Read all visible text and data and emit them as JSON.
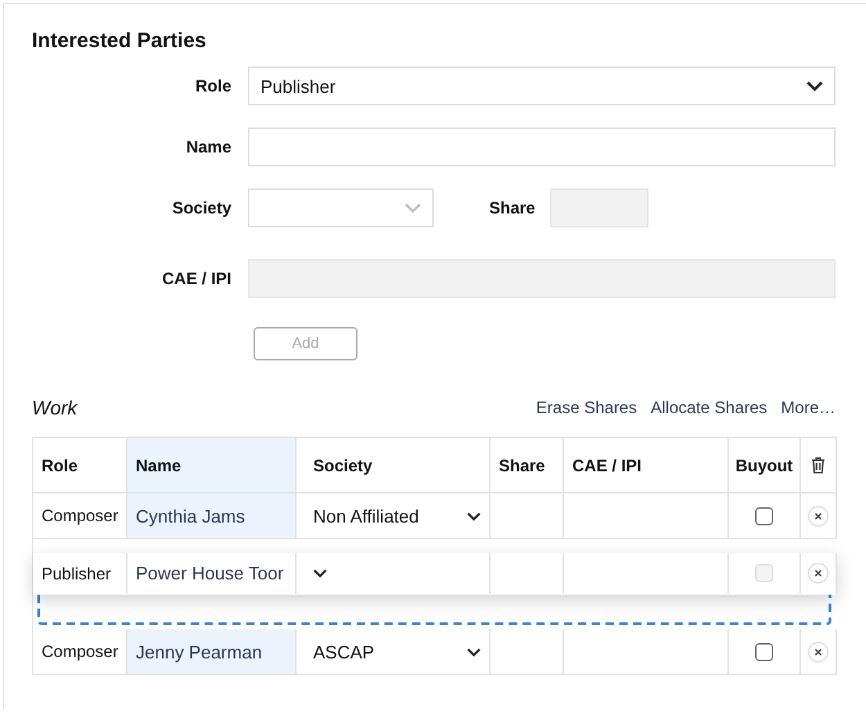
{
  "interested_parties": {
    "title": "Interested Parties",
    "role": {
      "label": "Role",
      "value": "Publisher"
    },
    "name": {
      "label": "Name"
    },
    "society": {
      "label": "Society",
      "disabled": true
    },
    "share": {
      "label": "Share",
      "disabled": true
    },
    "cae_ipi": {
      "label": "CAE / IPI",
      "disabled": true
    },
    "add_button": {
      "label": "Add",
      "disabled": true
    }
  },
  "work": {
    "title": "Work",
    "actions": [
      "Erase Shares",
      "Allocate Shares",
      "More…"
    ],
    "columns": [
      "Role",
      "Name",
      "Society",
      "Share",
      "CAE / IPI",
      "Buyout"
    ],
    "rows": [
      {
        "kind": "row",
        "role": "Composer",
        "name": "Cynthia Jams",
        "society": "Non Affiliated",
        "buyout": {
          "checked": false
        }
      },
      {
        "kind": "dragging",
        "role": "Publisher",
        "name": "Power House Toor",
        "buyout": {
          "checked": false
        }
      },
      {
        "kind": "drop-slot"
      },
      {
        "kind": "row",
        "role": "Composer",
        "name": "Jenny Pearman",
        "society": "ASCAP",
        "buyout": {
          "checked": false
        }
      }
    ]
  }
}
